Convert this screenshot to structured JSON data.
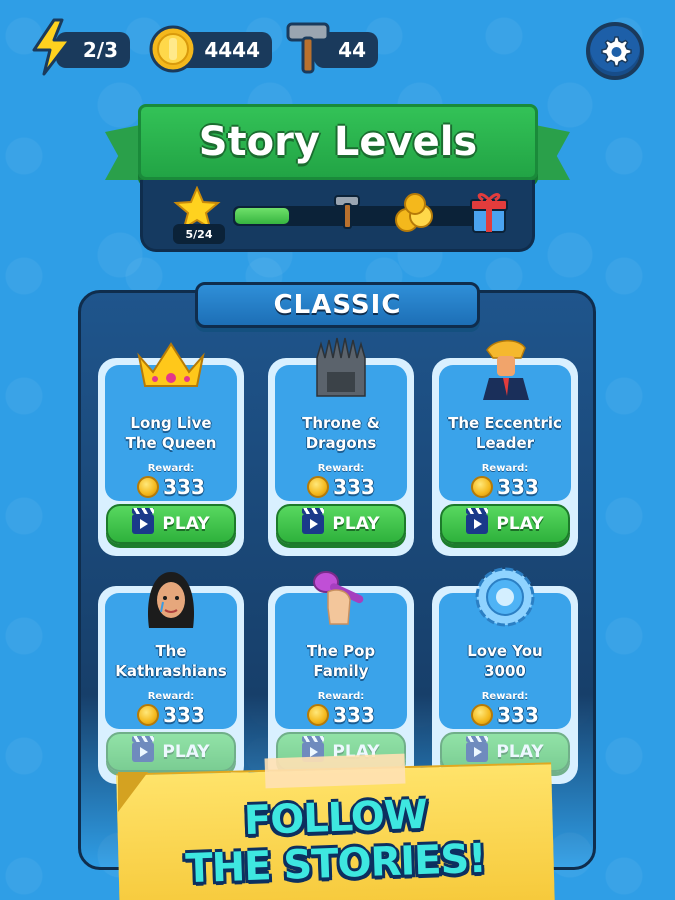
{
  "hud": {
    "energy": "2/3",
    "coins": "4444",
    "hammers": "44",
    "energy_icon": "lightning-icon",
    "coin_icon": "coin-icon",
    "hammer_icon": "hammer-icon",
    "settings_icon": "gear-icon"
  },
  "title": "Story Levels",
  "progress": {
    "label": "5/24",
    "fraction": 0.208,
    "milestones": [
      "star-icon",
      "hammer-icon",
      "coins-icon",
      "gift-icon"
    ]
  },
  "section": {
    "title": "CLASSIC"
  },
  "levels": [
    {
      "title": "Long Live\nThe Queen",
      "reward_label": "Reward:",
      "reward": "333",
      "play": "PLAY",
      "art": "crown-icon"
    },
    {
      "title": "Throne &\nDragons",
      "reward_label": "Reward:",
      "reward": "333",
      "play": "PLAY",
      "art": "throne-icon"
    },
    {
      "title": "The Eccentric\nLeader",
      "reward_label": "Reward:",
      "reward": "333",
      "play": "PLAY",
      "art": "leader-icon"
    },
    {
      "title": "The\nKathrashians",
      "reward_label": "Reward:",
      "reward": "333",
      "play": "PLAY",
      "art": "woman-face-icon"
    },
    {
      "title": "The Pop\nFamily",
      "reward_label": "Reward:",
      "reward": "333",
      "play": "PLAY",
      "art": "microphone-hand-icon"
    },
    {
      "title": "Love You\n3000",
      "reward_label": "Reward:",
      "reward": "333",
      "play": "PLAY",
      "art": "shield-disc-icon"
    }
  ],
  "banner": {
    "line1": "FOLLOW",
    "line2": "THE STORIES!"
  },
  "colors": {
    "background": "#2f9ee6",
    "ribbon_green": "#2aa04a",
    "board_navy": "#173f6a",
    "play_green": "#3bbf46",
    "banner_yellow": "#f6c93a",
    "banner_text": "#3ee7e0"
  }
}
